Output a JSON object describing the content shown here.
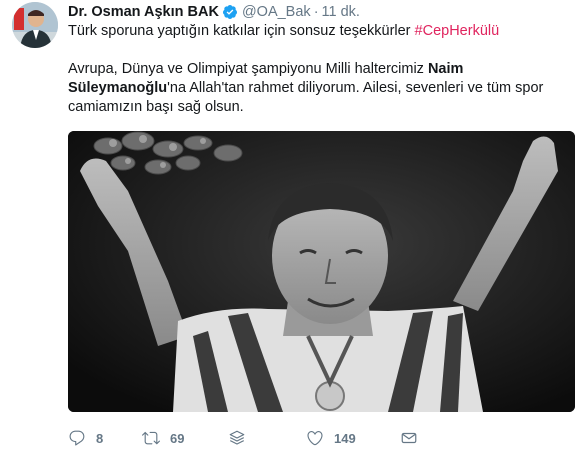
{
  "tweet": {
    "author_name": "Dr. Osman Aşkın BAK",
    "handle": "@OA_Bak",
    "separator": "·",
    "time": "11 dk.",
    "line1_text": "Türk sporuna yaptığın katkılar için sonsuz teşekkürler ",
    "line1_hashtag": "#CepHerkülü",
    "line2_part1": "Avrupa, Dünya ve Olimpiyat şampiyonu Milli haltercimiz ",
    "line2_bold": "Naim Süleymanoğlu",
    "line2_part2": "'na Allah'tan rahmet diliyorum. Ailesi, sevenleri ve tüm spor camiamızın başı sağ olsun.",
    "accent_color": "#e0245e",
    "verified_color": "#1da1f2"
  },
  "actions": {
    "reply_count": "8",
    "retweet_count": "69",
    "like_count": "149",
    "icons": [
      "reply-icon",
      "retweet-icon",
      "stack-icon",
      "heart-icon",
      "mail-icon"
    ]
  }
}
